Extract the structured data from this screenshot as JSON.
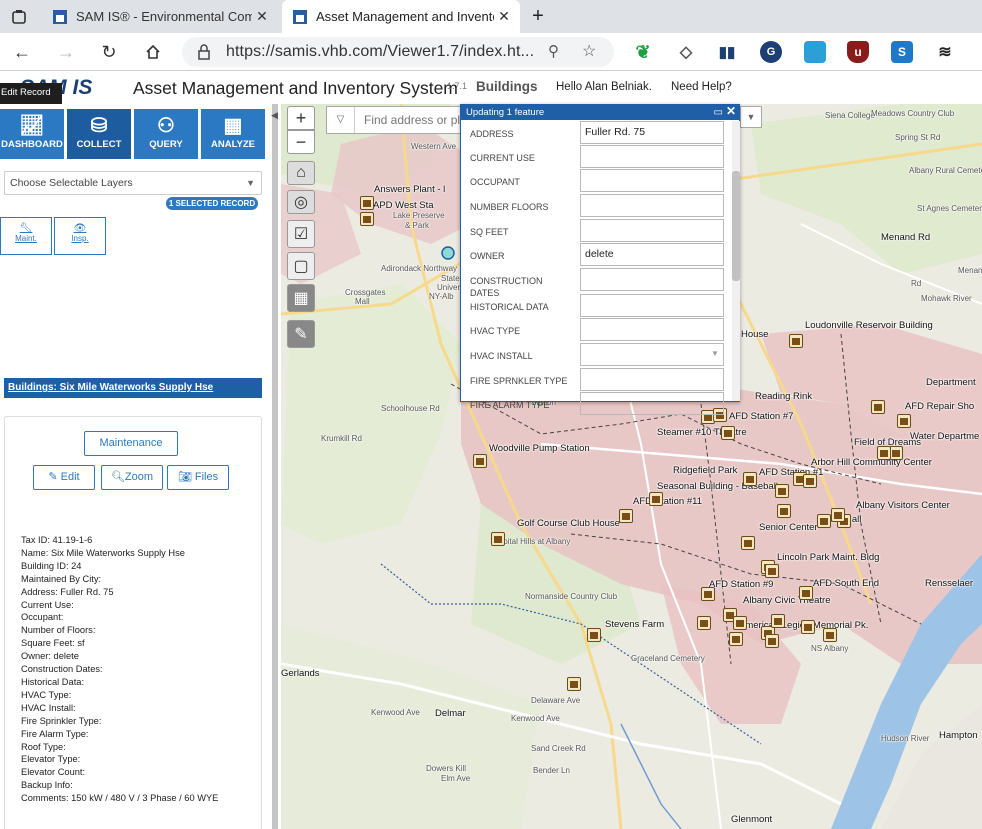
{
  "browser": {
    "tabs": [
      {
        "title": "SAM IS® - Environmental Comp",
        "active": false
      },
      {
        "title": "Asset Management and Inventor",
        "active": true
      }
    ],
    "new_tab_label": "+",
    "url": "https://samis.vhb.com/Viewer1.7/index.ht..."
  },
  "app": {
    "logo": "SAM IS",
    "title": "Asset Management and Inventory System",
    "version": "1.7.1",
    "module": "Buildings",
    "greeting": "Hello Alan Belniak.",
    "help": "Need Help?",
    "tooltip": "Edit Record"
  },
  "nav": {
    "dashboard": "DASHBOARD",
    "collect": "COLLECT",
    "query": "QUERY",
    "analyze": "ANALYZE"
  },
  "left_panel": {
    "layer_select": "Choose Selectable Layers",
    "selected_badge": "1 SELECTED RECORD",
    "maint": "Maint.",
    "insp": "Insp.",
    "record_title": "Buildings: Six Mile Waterworks Supply Hse",
    "maintenance_btn": "Maintenance",
    "edit_btn": "Edit",
    "zoom_btn": "Zoom",
    "files_btn": "Files",
    "attributes": [
      "Tax ID: 41.19-1-6",
      "Name: Six Mile Waterworks Supply Hse",
      "Building ID: 24",
      "Maintained By City:",
      "Address: Fuller Rd. 75",
      "Current Use:",
      "Occupant:",
      "Number of Floors:",
      "Square Feet:  sf",
      "Owner: delete",
      "Construction Dates:",
      "Historical Data:",
      "HVAC Type:",
      "HVAC Install:",
      "Fire Sprinkler Type:",
      "Fire Alarm Type:",
      "Roof Type:",
      "Elevator Type:",
      "Elevator Count:",
      "Backup Info:",
      "Comments: 150 kW / 480 V / 3 Phase / 60 WYE"
    ]
  },
  "map": {
    "search_placeholder": "Find address or pla",
    "labels": [
      "Answers Plant - l",
      "APD West Sta",
      "Lake Preserve",
      "& Park",
      "Crossgates",
      "Mall",
      "State",
      "University",
      "NY-Alb",
      "Loudonville Reservoir Building",
      "House",
      "Department",
      "AFD Repair Sho",
      "Water Departme",
      "Field of Dreams",
      "Arbor Hill Community Center",
      "Albany Visitors Center",
      "AFD Station #7",
      "Steamer #10 Theatre",
      "Ridgefield Park",
      "AFD Station #1",
      "Seasonal Building - Baseball",
      "AFD Station #11",
      "Senior Center",
      "City Hall",
      "Golf Course Club House",
      "Woodville Pump Station",
      "Lincoln Park Maint. Bldg",
      "AFD Station #9",
      "AFD South End",
      "Albany Civic Theatre",
      "American Legion Memorial Pk.",
      "Stevens Farm",
      "Rensselaer",
      "Delmar",
      "Glenmont",
      "Hampton",
      "Gerlands",
      "Capital Hills at Albany",
      "Normanside Country Club",
      "Graceland Cemetery",
      "Albany Rural Cemetery",
      "Siena College",
      "Meadows Country Club",
      "St Agnes Cemetery",
      "Menand Rd",
      "Menands",
      "Krumkill Rd",
      "Spring St Rd",
      "Kenwood Ave",
      "Delaware Ave",
      "Dowers Kill",
      "Elm Ave",
      "Sand Creek Rd",
      "Adirondack Northway",
      "Western Ave",
      "Schoolhouse Rd",
      "Bender Ln",
      "Kenwood Ave",
      "Mohawk River",
      "Hudson River",
      "Rd",
      "Station",
      "Reading Rink",
      "NS Albany"
    ]
  },
  "popup": {
    "title": "Updating 1 feature",
    "fields": [
      {
        "label": "ADDRESS",
        "value": "Fuller Rd. 75"
      },
      {
        "label": "CURRENT USE",
        "value": ""
      },
      {
        "label": "OCCUPANT",
        "value": ""
      },
      {
        "label": "NUMBER FLOORS",
        "value": ""
      },
      {
        "label": "SQ FEET",
        "value": ""
      },
      {
        "label": "OWNER",
        "value": "delete"
      },
      {
        "label": "CONSTRUCTION DATES",
        "value": ""
      },
      {
        "label": "HISTORICAL DATA",
        "value": ""
      },
      {
        "label": "HVAC TYPE",
        "value": ""
      },
      {
        "label": "HVAC INSTALL",
        "value": ""
      },
      {
        "label": "FIRE SPRNKLER TYPE",
        "value": ""
      },
      {
        "label": "FIRE ALARM TYPE",
        "value": ""
      }
    ]
  }
}
